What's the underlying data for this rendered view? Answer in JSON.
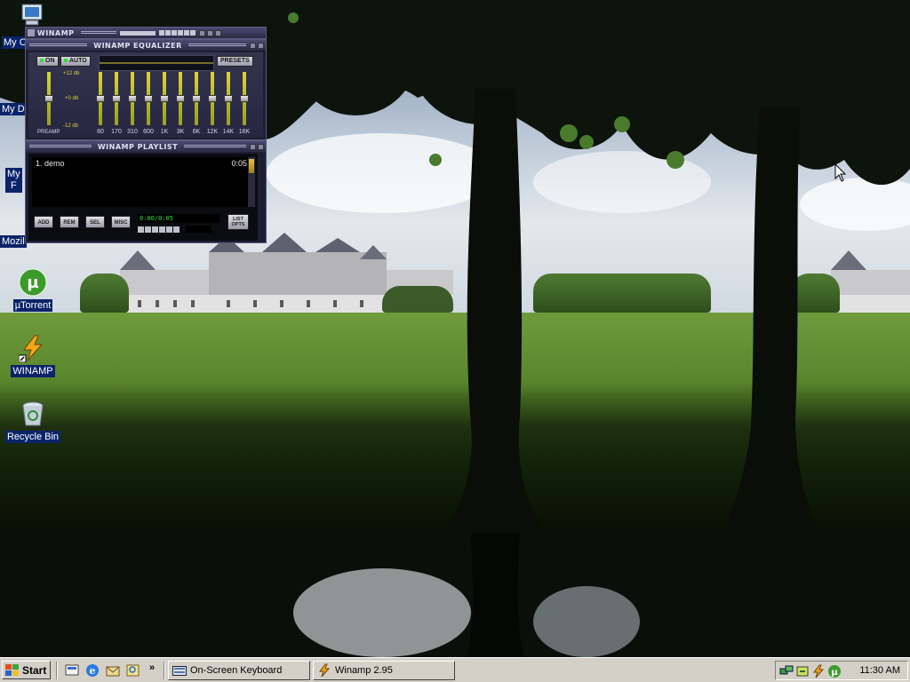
{
  "desktop": {
    "icons": [
      {
        "label": "My C"
      },
      {
        "label": "My D"
      },
      {
        "label": "My\nF"
      },
      {
        "label": "Mozil"
      },
      {
        "label": "µTorrent"
      },
      {
        "label": "WINAMP"
      },
      {
        "label": "Recycle Bin"
      }
    ]
  },
  "winamp": {
    "main_title": "WINAMP",
    "equalizer": {
      "title": "WINAMP EQUALIZER",
      "on_label": "ON",
      "auto_label": "AUTO",
      "presets_label": "PRESETS",
      "db_top": "+12 db",
      "db_mid": "+0 db",
      "db_bottom": "-12 db",
      "preamp_label": "PREAMP",
      "bands": [
        "60",
        "170",
        "310",
        "600",
        "1K",
        "3K",
        "6K",
        "12K",
        "14K",
        "16K"
      ]
    },
    "playlist": {
      "title": "WINAMP PLAYLIST",
      "items": [
        {
          "name": "1. demo",
          "duration": "0:05"
        }
      ],
      "buttons": {
        "add": "ADD",
        "rem": "REM",
        "sel": "SEL",
        "misc": "MISC",
        "list_opts_1": "LIST",
        "list_opts_2": "OPTS"
      },
      "time_display": "0:00/0:05",
      "mini_time": ":"
    }
  },
  "taskbar": {
    "start_label": "Start",
    "tasks": [
      {
        "label": "On-Screen Keyboard"
      },
      {
        "label": "Winamp 2.95"
      }
    ],
    "clock": "11:30 AM"
  }
}
